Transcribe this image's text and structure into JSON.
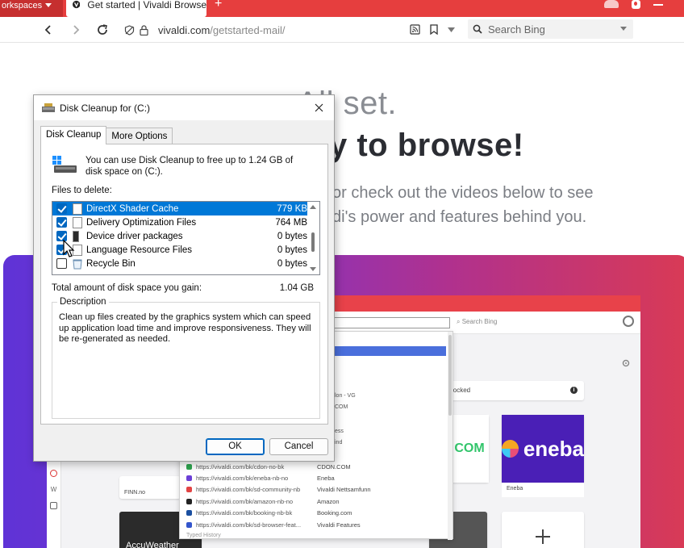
{
  "browser": {
    "workspaces_label": "orkspaces",
    "tab_title": "Get started | Vivaldi Browse",
    "new_tab": "+",
    "url_domain": "vivaldi.com",
    "url_path": "/getstarted-mail/",
    "search_placeholder": "Search Bing"
  },
  "page": {
    "line1": "All set.",
    "line2": "y to browse!",
    "para1": "or check out the videos below to see",
    "para2": "di's power and features behind you."
  },
  "video": {
    "inner_search": "Search Bing",
    "blocked_text": "locked",
    "blocked_info": "i",
    "card_eneba": "eneba",
    "card_eneba_caption": "Eneba",
    "card_cdon": "COM",
    "card_finn_caption": "FINN.no",
    "card_accu": "AccuWeather",
    "typed_history": "Typed History",
    "side_labels": [
      "lon - VG",
      "COM",
      "ess",
      "ind"
    ],
    "autocomplete": [
      {
        "url": "https://vivaldi.com/bk/cdon-no-bk",
        "title": "CDON.COM",
        "color": "#2ea44f"
      },
      {
        "url": "https://vivaldi.com/bk/eneba-nb-no",
        "title": "Eneba",
        "color": "#6b3fd6"
      },
      {
        "url": "https://vivaldi.com/bk/sd-community-nb",
        "title": "Vivaldi Nettsamfunn",
        "color": "#e24444"
      },
      {
        "url": "https://vivaldi.com/bk/amazon-nb-no",
        "title": "Amazon",
        "color": "#222222"
      },
      {
        "url": "https://vivaldi.com/bk/booking-nb-bk",
        "title": "Booking.com",
        "color": "#1a4fa0"
      },
      {
        "url": "https://vivaldi.com/bk/sd-browser-feat...",
        "title": "Vivaldi Features",
        "color": "#3355cc"
      }
    ]
  },
  "dialog": {
    "title": "Disk Cleanup for  (C:)",
    "tabs": [
      "Disk Cleanup",
      "More Options"
    ],
    "intro": "You can use Disk Cleanup to free up to 1.24 GB of disk space on  (C:).",
    "files_label": "Files to delete:",
    "files": [
      {
        "name": "DirectX Shader Cache",
        "size": "779 KB",
        "checked": true,
        "selected": true
      },
      {
        "name": "Delivery Optimization Files",
        "size": "764 MB",
        "checked": true,
        "selected": false
      },
      {
        "name": "Device driver packages",
        "size": "0 bytes",
        "checked": true,
        "selected": false
      },
      {
        "name": "Language Resource Files",
        "size": "0 bytes",
        "checked": true,
        "selected": false
      },
      {
        "name": "Recycle Bin",
        "size": "0 bytes",
        "checked": false,
        "selected": false
      }
    ],
    "total_label": "Total amount of disk space you gain:",
    "total_value": "1.04 GB",
    "desc_label": "Description",
    "desc_text": "Clean up files created by the graphics system which can speed up application load time and improve responsiveness. They will be re-generated as needed.",
    "ok": "OK",
    "cancel": "Cancel"
  },
  "colors": {
    "vivaldi_red": "#e63e3e",
    "selection_blue": "#0078d7",
    "checkbox_blue": "#0067c0"
  }
}
